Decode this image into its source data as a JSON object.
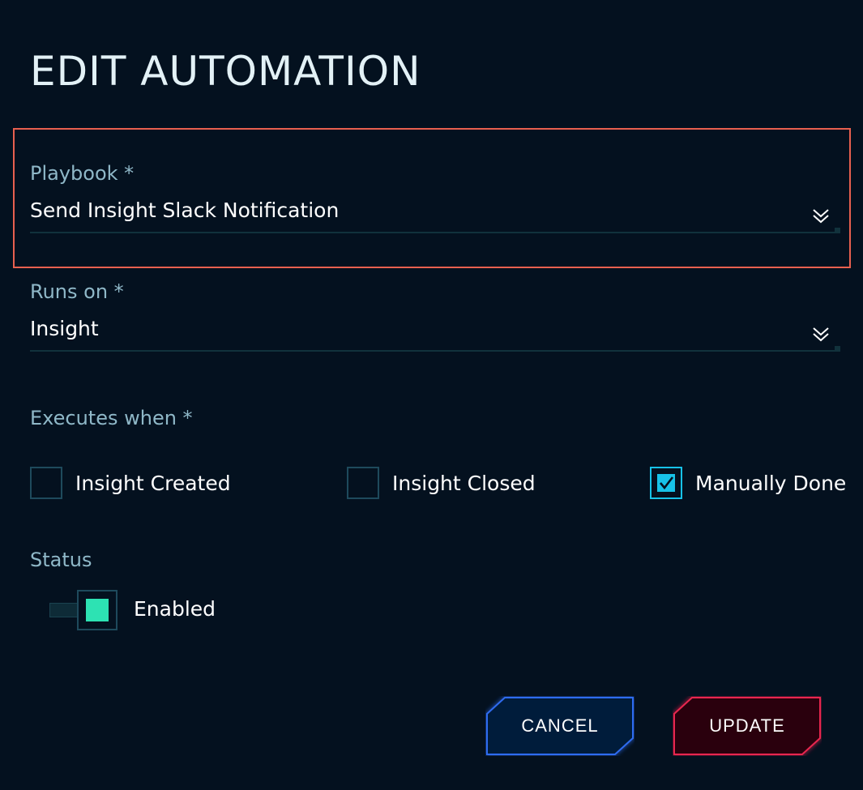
{
  "title": "EDIT AUTOMATION",
  "playbook": {
    "label": "Playbook *",
    "value": "Send Insight Slack Notification"
  },
  "runs_on": {
    "label": "Runs on *",
    "value": "Insight"
  },
  "executes_when": {
    "label": "Executes when *",
    "options": [
      {
        "label": "Insight Created",
        "checked": false
      },
      {
        "label": "Insight Closed",
        "checked": false
      },
      {
        "label": "Manually Done",
        "checked": true
      }
    ]
  },
  "status": {
    "label": "Status",
    "toggle_label": "Enabled",
    "enabled": true
  },
  "buttons": {
    "cancel": "CANCEL",
    "update": "UPDATE"
  },
  "colors": {
    "background": "#04111f",
    "highlight_border": "#e8604f",
    "label": "#8fb8c8",
    "checkbox_checked": "#17c2e8",
    "toggle_on": "#2de2b3",
    "cancel_border": "#2f6cf0",
    "update_border": "#e8284f"
  }
}
